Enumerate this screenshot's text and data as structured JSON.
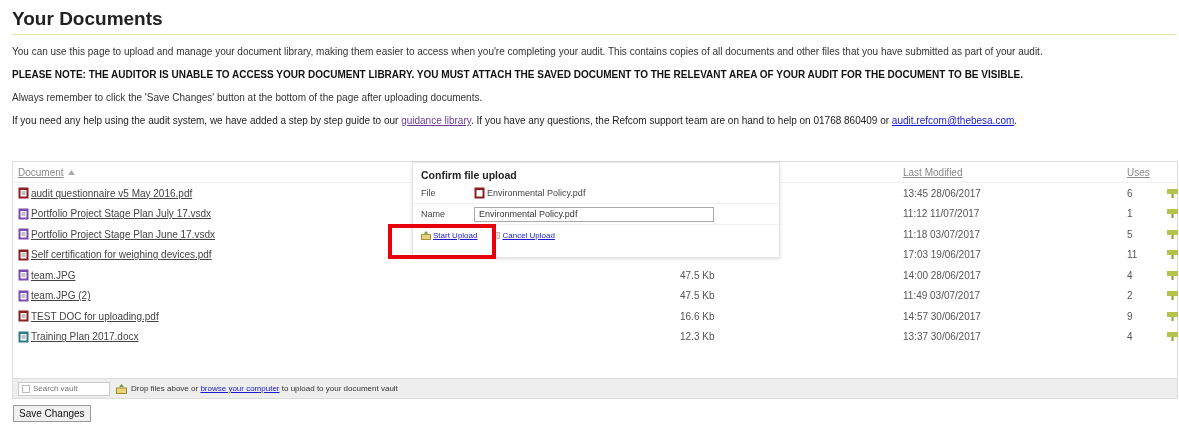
{
  "title": "Your Documents",
  "intro": "You can use this page to upload and manage your document library, making them easier to access when you're completing your audit. This contains copies of all documents and other files that you have submitted as part of your audit.",
  "notice": "PLEASE NOTE: THE AUDITOR IS UNABLE TO ACCESS YOUR DOCUMENT LIBRARY. YOU MUST ATTACH THE SAVED DOCUMENT TO THE RELEVANT AREA OF YOUR AUDIT FOR THE DOCUMENT TO BE VISIBLE.",
  "reminder": "Always remember to click the 'Save Changes' button at the bottom of the page after uploading documents.",
  "help": {
    "before": "If you need any help using the audit system, we have added a step by step guide to our ",
    "link": "guidance library",
    "middle": ". If you have any questions, the Refcom support team are on hand to help on 01768 860409 or ",
    "email": "audit.refcom@thebesa.com",
    "after": "."
  },
  "table": {
    "columns": [
      "Document",
      "Last Modified",
      "Uses"
    ],
    "rows": [
      {
        "kind": "pdf",
        "name": "audit questionnaire v5 May 2016.pdf",
        "modified": "13:45 28/06/2017",
        "uses": "6"
      },
      {
        "kind": "visio",
        "name": "Portfolio Project Stage Plan July 17.vsdx",
        "modified": "11:12 11/07/2017",
        "uses": "1"
      },
      {
        "kind": "visio",
        "name": "Portfolio Project Stage Plan June 17.vsdx",
        "modified": "11:18 03/07/2017",
        "uses": "5"
      },
      {
        "kind": "pdf",
        "name": "Self certification for weighing devices.pdf",
        "modified": "17:03 19/06/2017",
        "uses": "11"
      },
      {
        "kind": "visio",
        "name": "team.JPG",
        "size": "47.5 Kb",
        "modified": "14:00 28/06/2017",
        "uses": "4"
      },
      {
        "kind": "visio",
        "name": "team.JPG (2)",
        "size": "47.5 Kb",
        "modified": "11:49 03/07/2017",
        "uses": "2"
      },
      {
        "kind": "pdf",
        "name": "TEST DOC for uploading.pdf",
        "size": "16.6 Kb",
        "modified": "14:57 30/06/2017",
        "uses": "9"
      },
      {
        "kind": "word",
        "name": "Training Plan 2017.docx",
        "size": "12.3 Kb",
        "modified": "13:37 30/06/2017",
        "uses": "4"
      }
    ]
  },
  "dialog": {
    "title": "Confirm file upload",
    "file_label": "File",
    "file_name": "Environmental Policy.pdf",
    "name_label": "Name",
    "name_value": "Environmental Policy.pdf",
    "start": "Start Upload",
    "cancel": "Cancel Upload"
  },
  "footer": {
    "search_placeholder": "Search vault",
    "before": "Drop files above or ",
    "link": "browse your computer",
    "after": " to upload to your document vault"
  },
  "save_button": "Save Changes"
}
